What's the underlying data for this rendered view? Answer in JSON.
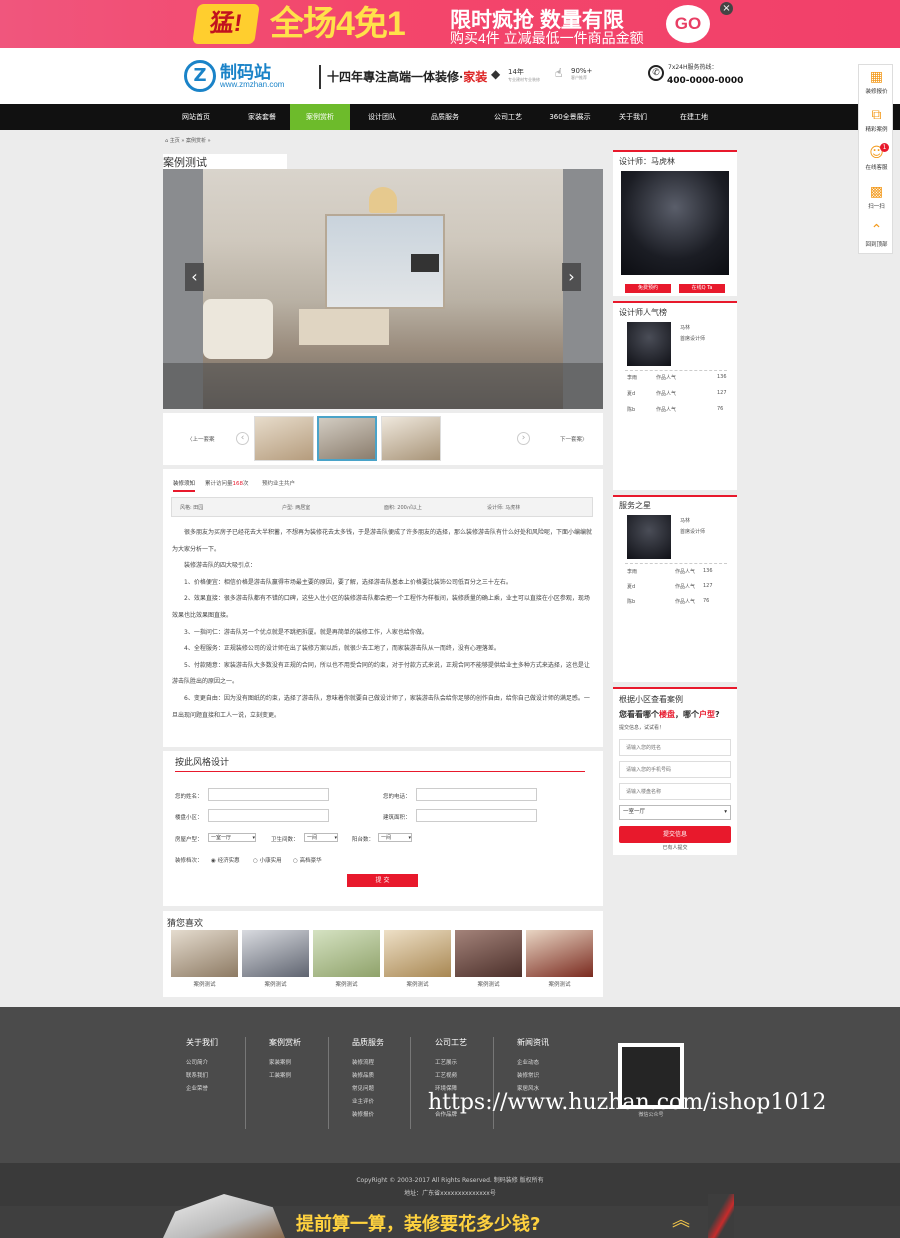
{
  "promo": {
    "badge": "猛!",
    "headline": "全场4免1",
    "line1": "限时疯抢 数量有限",
    "line2": "购买4件 立减最低一件商品金额",
    "go": "GO",
    "close": "×"
  },
  "header": {
    "logo_name": "制码站",
    "logo_url": "www.zmzhan.com",
    "slogan_a": "十四年專注高端一体装修·",
    "slogan_b": "家装",
    "stat1_top": "14年",
    "stat1_sub": "专业建材专业装修",
    "stat2_top": "90%+",
    "stat2_sub": "客户推荐",
    "hotline_label": "7x24H服务热线：",
    "hotline": "400-0000-0000"
  },
  "nav": {
    "items": [
      "网站首页",
      "家装套餐",
      "案例赏析",
      "设计团队",
      "品质服务",
      "公司工艺",
      "360全景展示",
      "关于我们",
      "在建工地"
    ],
    "active_index": 2
  },
  "breadcrumb": "主页 » 案例赏析 »",
  "case": {
    "title": "案例测试",
    "prev": "〈上一套案",
    "next": "下一套案〉",
    "tabs": [
      "装修须知",
      "累计访问量",
      "168次",
      "预约业主共户"
    ],
    "tab_views_label": "累计访问量",
    "tab_views_value": "168",
    "tab_views_unit": "次",
    "meta": [
      {
        "k": "风格:",
        "v": "田园"
      },
      {
        "k": "户型:",
        "v": "两居室"
      },
      {
        "k": "面积:",
        "v": "200㎡以上"
      },
      {
        "k": "设计师:",
        "v": "马虎林"
      }
    ],
    "paragraphs": [
      "很多朋友为买房子已经花去大半积蓄，不想再为装修花去太多钱，于是游击队便成了许多朋友的选择，那么装修游击队有什么好处和风险呢，下面小编编就为大家分析一下。",
      "装修游击队的四大吸引点：",
      "1、价格便宜：相信价格是游击队赢得市场最主要的原因，要了解，选择游击队基本上价格要比装饰公司低百分之三十左右。",
      "2、效果直接：很多游击队都有不错的口碑，这些入住小区的装修游击队都会把一个工程作为样板间，装修质量的确上乘，业主可以直接在小区参观，现场效果也比效果图直接。",
      "3、一指问仁：游击队另一个优点就是不跳把拆厦。就是再简单的装修工作，人家也给你做。",
      "4、全程服务：正规装修公司的设计师在出了装修方案以后，就很少去工地了，而家装游击队从一而终，没有心理落差。",
      "5、付款随意：家装游击队大多数没有正规的合同，所以也不用受合同的约束，对于付款方式来说，正规合同不能够提供给业主多种方式来选择，这也是让游击队胜出的原因之一。",
      "6、变更自由：因为没有图纸的约束，选择了游击队，意味着你就要自己做设计师了，家装游击队会给你足够的创作自由，给你自己做设计师的满足感。一旦出现问题直接和工人一说，立刻变更。"
    ]
  },
  "style_form": {
    "title": "按此风格设计",
    "name_label": "您的姓名：",
    "phone_label": "您的电话：",
    "community_label": "楼盘小区：",
    "area_label": "建筑面积：",
    "room_label": "房屋户型：",
    "room_value": "一室一厅",
    "bath_label": "卫生间数：",
    "bath_value": "一间",
    "balcony_label": "阳台数：",
    "balcony_value": "一间",
    "grade_label": "装修档次：",
    "grades": [
      "经济实惠",
      "小康实用",
      "高档豪华"
    ],
    "submit": "提 交"
  },
  "likes": {
    "title": "猜您喜欢",
    "items": [
      "案例测试",
      "案例测试",
      "案例测试",
      "案例测试",
      "案例测试",
      "案例测试"
    ]
  },
  "designer": {
    "title": "设计师：马虎林",
    "btn1": "免费预约",
    "btn2": "在线Q Ta"
  },
  "popular": {
    "title": "设计师人气榜",
    "top_name": "马林",
    "top_role": "首席设计师",
    "rows": [
      {
        "n": "李雨",
        "l": "作品人气",
        "c": "136"
      },
      {
        "n": "夏d",
        "l": "作品人气",
        "c": "127"
      },
      {
        "n": "陈b",
        "l": "作品人气",
        "c": "76"
      }
    ]
  },
  "service": {
    "title": "服务之星",
    "top_name": "马林",
    "top_role": "首席设计师",
    "rows": [
      {
        "n": "李雨",
        "l": "作品人气",
        "c": "136"
      },
      {
        "n": "夏d",
        "l": "作品人气",
        "c": "127"
      },
      {
        "n": "陈b",
        "l": "作品人气",
        "c": "76"
      }
    ]
  },
  "lookup": {
    "title": "根据小区查看案例",
    "q_a": "您看看哪个",
    "q_b": "楼盘",
    "q_c": "，哪个",
    "q_d": "户型",
    "q_e": "?",
    "hint": "提交信息，试试看！",
    "ph_name": "请输入您的姓名",
    "ph_phone": "请输入您的手机号码",
    "ph_community": "请输入楼盘名称",
    "select": "一室一厅",
    "submit": "提交信息",
    "note": "已有人提交"
  },
  "float_bar": [
    "装修报价",
    "精彩案例",
    "在线客服",
    "扫一扫",
    "回到顶部"
  ],
  "float_badge": "1",
  "footer": {
    "cols": [
      {
        "h": "关于我们",
        "items": [
          "公司简介",
          "联系我们",
          "企业荣誉"
        ]
      },
      {
        "h": "案例赏析",
        "items": [
          "家装案例",
          "工装案例"
        ]
      },
      {
        "h": "品质服务",
        "items": [
          "装修流程",
          "装修品质",
          "常见问题",
          "业主评价",
          "装修报价"
        ]
      },
      {
        "h": "公司工艺",
        "items": [
          "工艺展示",
          "工艺视频",
          "环境保障",
          "",
          "合作品牌"
        ]
      },
      {
        "h": "新闻资讯",
        "items": [
          "企业动态",
          "装修常识",
          "家居风水"
        ]
      }
    ],
    "qr_caption": "微信公众号",
    "copyright": "CopyRight © 2003-2017 All Rights Reserved. 制码装修 版权所有",
    "address": "地址：广东省xxxxxxxxxxxxxx号",
    "watermark": "https://www.huzhan.com/ishop1012"
  },
  "bottom_banner": "提前算一算，装修要花多少钱?"
}
